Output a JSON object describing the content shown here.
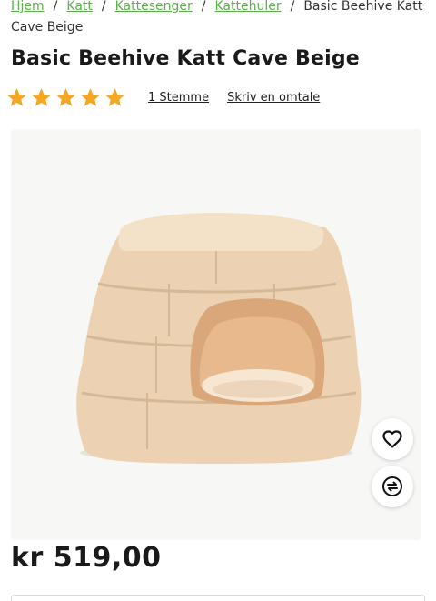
{
  "breadcrumb": {
    "items": [
      "Hjem",
      "Katt",
      "Kattesenger",
      "Kattehuler"
    ],
    "current": "Basic Beehive Katt Cave Beige",
    "separator": "/"
  },
  "product": {
    "title": "Basic Beehive Katt Cave Beige",
    "price": "kr 519,00",
    "rating": {
      "value": 5,
      "max": 5,
      "count_label": "1 Stemme",
      "review_label": "Skriv en omtale"
    },
    "image_icon": "cat-bed-beehive-image"
  },
  "actions": {
    "favorite_icon": "heart-icon",
    "compare_icon": "compare-icon"
  },
  "colors": {
    "link": "#5bb04a",
    "star": "#f5a623",
    "text": "#1a1a1a"
  }
}
